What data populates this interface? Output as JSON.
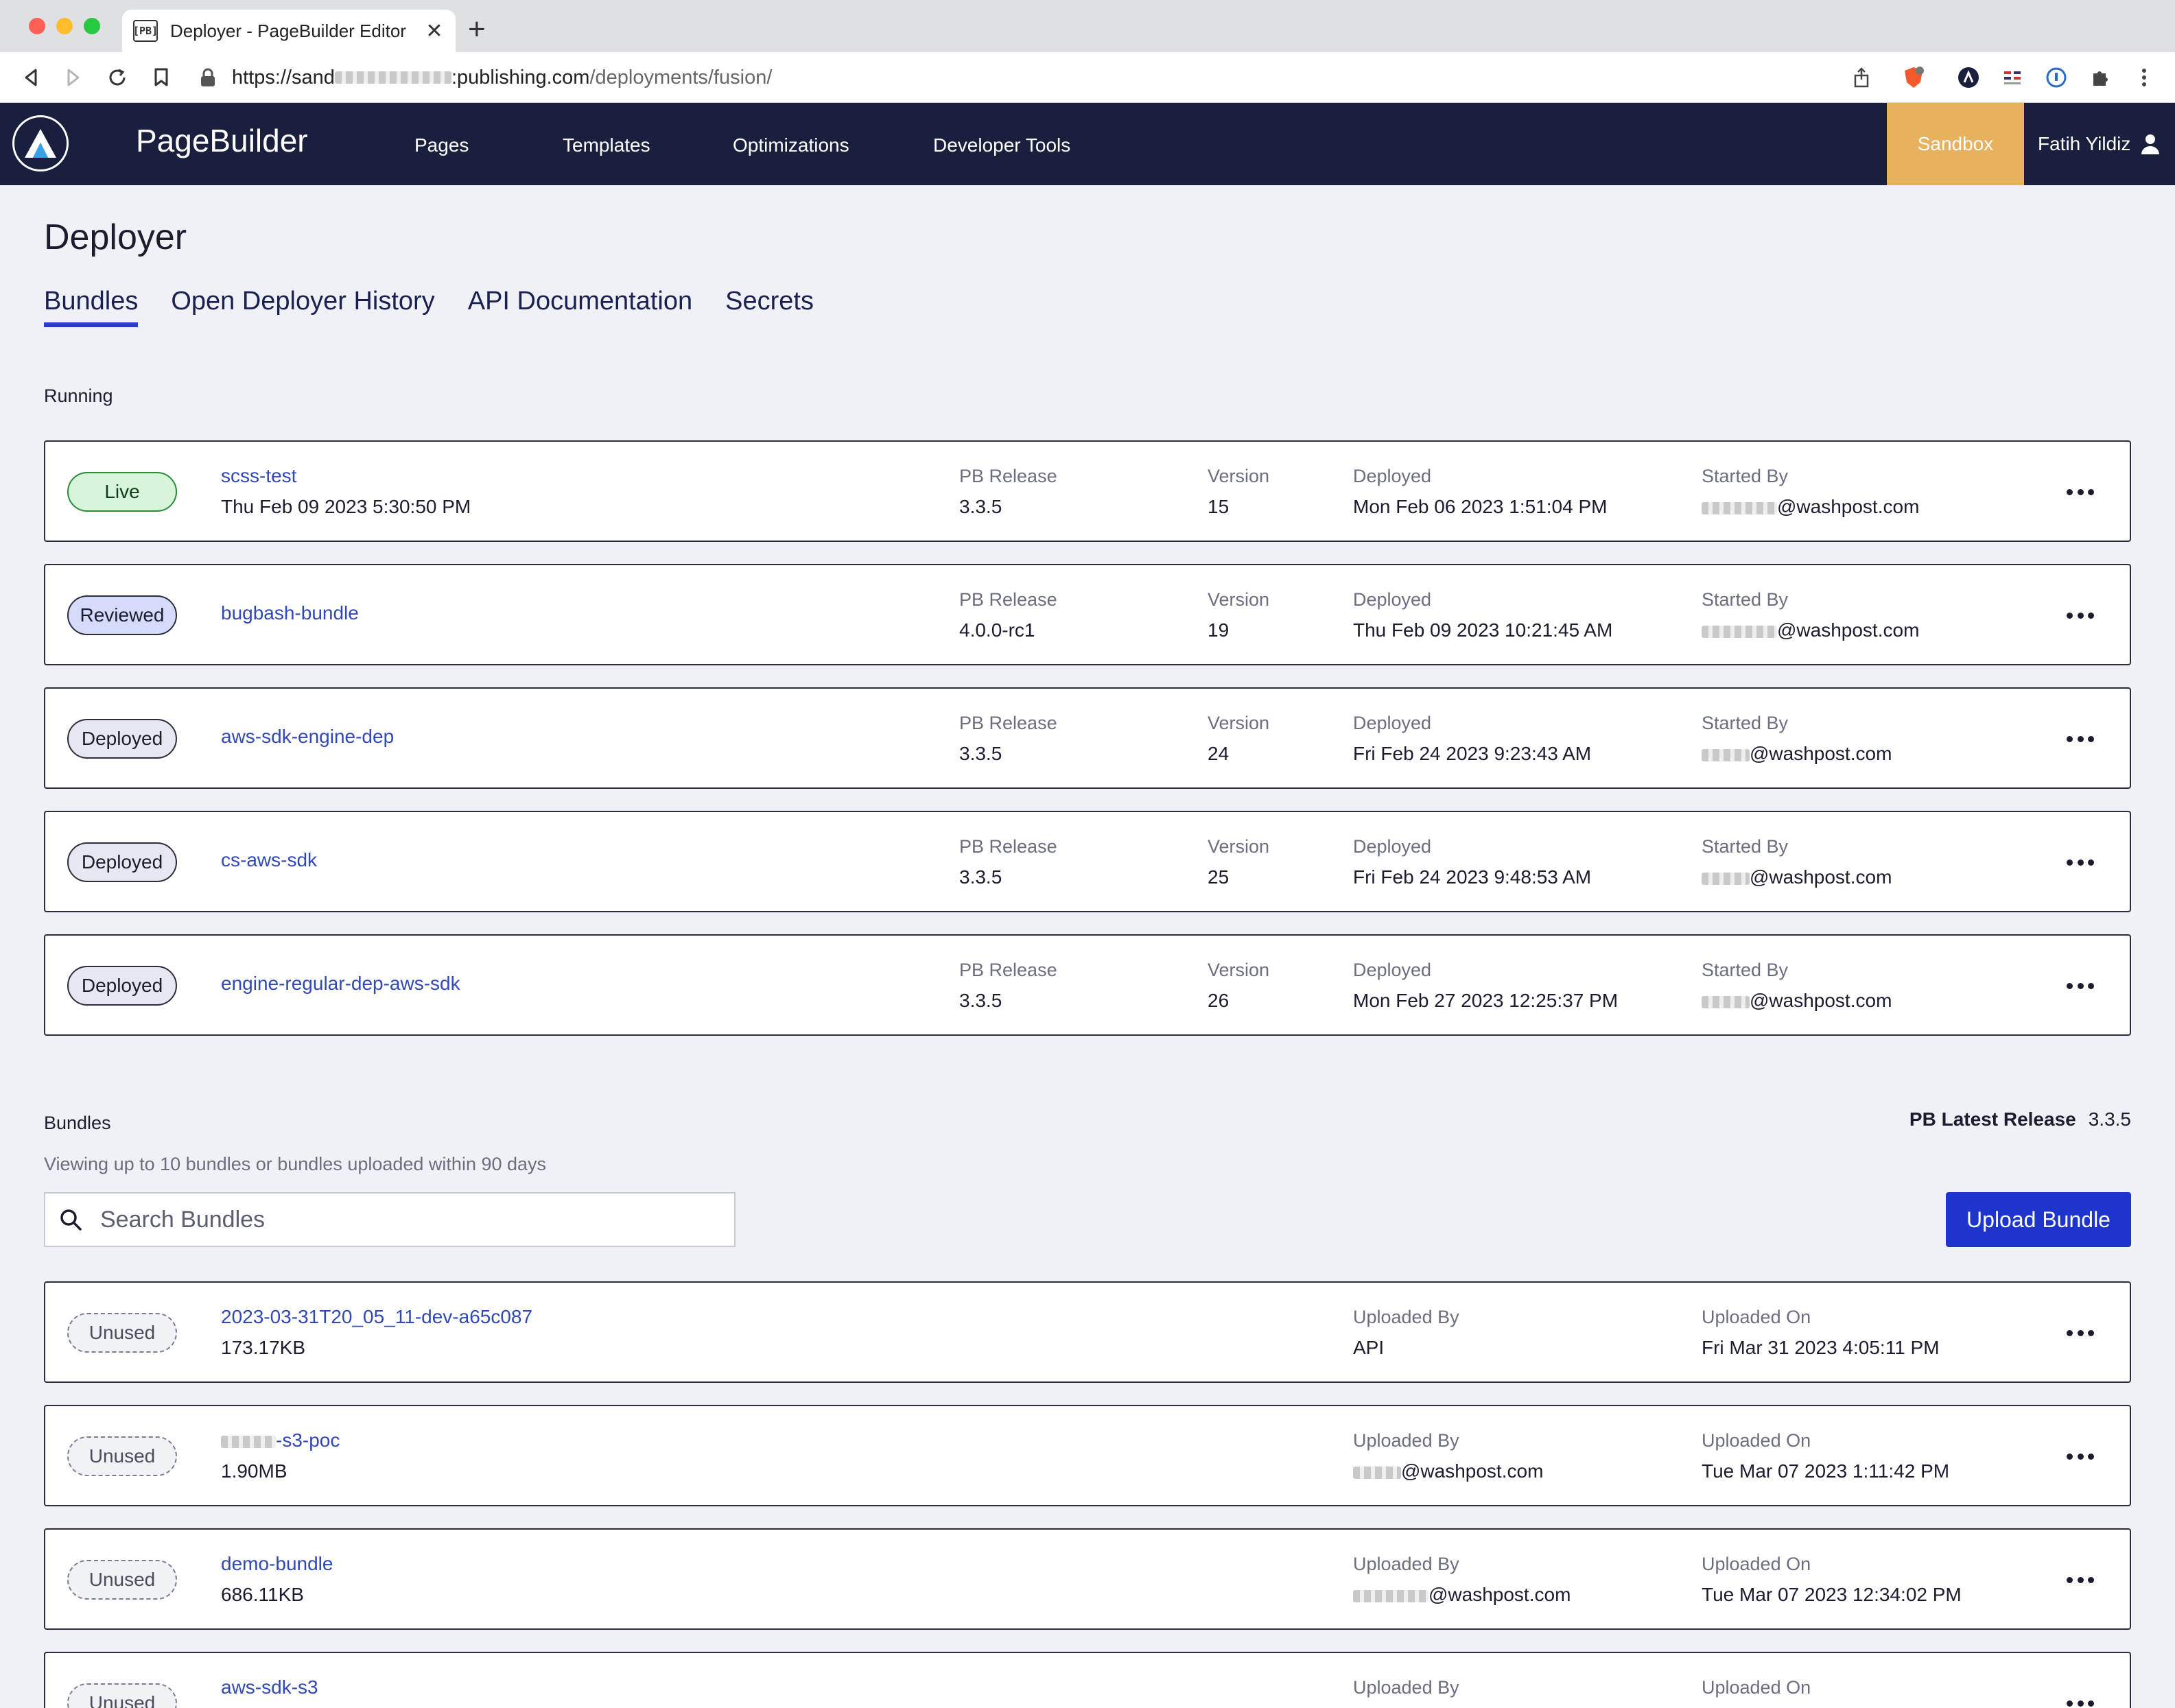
{
  "browser": {
    "tab_title": "Deployer - PageBuilder Editor",
    "favicon_text": "[PB]",
    "url_prefix": "https://sand",
    "url_domain": ":publishing.com",
    "url_path": "/deployments/fusion/"
  },
  "header": {
    "brand": "PageBuilder",
    "nav": [
      "Pages",
      "Templates",
      "Optimizations",
      "Developer Tools"
    ],
    "env": "Sandbox",
    "user": "Fatih Yildiz"
  },
  "page": {
    "title": "Deployer",
    "tabs": [
      "Bundles",
      "Open Deployer History",
      "API Documentation",
      "Secrets"
    ]
  },
  "running": {
    "label": "Running",
    "col_release": "PB Release",
    "col_version": "Version",
    "col_deployed": "Deployed",
    "col_started": "Started By",
    "items": [
      {
        "status": "Live",
        "name": "scss-test",
        "date": "Thu Feb 09 2023 5:30:50 PM",
        "release": "3.3.5",
        "version": "15",
        "deployed": "Mon Feb 06 2023 1:51:04 PM",
        "started_by": "@washpost.com"
      },
      {
        "status": "Reviewed",
        "name": "bugbash-bundle",
        "date": "",
        "release": "4.0.0-rc1",
        "version": "19",
        "deployed": "Thu Feb 09 2023 10:21:45 AM",
        "started_by": "@washpost.com"
      },
      {
        "status": "Deployed",
        "name": "aws-sdk-engine-dep",
        "date": "",
        "release": "3.3.5",
        "version": "24",
        "deployed": "Fri Feb 24 2023 9:23:43 AM",
        "started_by": "@washpost.com"
      },
      {
        "status": "Deployed",
        "name": "cs-aws-sdk",
        "date": "",
        "release": "3.3.5",
        "version": "25",
        "deployed": "Fri Feb 24 2023 9:48:53 AM",
        "started_by": "@washpost.com"
      },
      {
        "status": "Deployed",
        "name": "engine-regular-dep-aws-sdk",
        "date": "",
        "release": "3.3.5",
        "version": "26",
        "deployed": "Mon Feb 27 2023 12:25:37 PM",
        "started_by": "@washpost.com"
      }
    ]
  },
  "bundles": {
    "label": "Bundles",
    "latest_label": "PB Latest Release",
    "latest_value": "3.3.5",
    "subtitle": "Viewing up to 10 bundles or bundles uploaded within 90 days",
    "search_placeholder": "Search Bundles",
    "upload_label": "Upload Bundle",
    "col_uploaded_by": "Uploaded By",
    "col_uploaded_on": "Uploaded On",
    "items": [
      {
        "status": "Unused",
        "name": "2023-03-31T20_05_11-dev-a65c087",
        "size": "173.17KB",
        "uploaded_by": "API",
        "uploaded_on": "Fri Mar 31 2023 4:05:11 PM"
      },
      {
        "status": "Unused",
        "name": "-s3-poc",
        "size": "1.90MB",
        "uploaded_by": "@washpost.com",
        "uploaded_on": "Tue Mar 07 2023 1:11:42 PM"
      },
      {
        "status": "Unused",
        "name": "demo-bundle",
        "size": "686.11KB",
        "uploaded_by": "@washpost.com",
        "uploaded_on": "Tue Mar 07 2023 12:34:02 PM"
      },
      {
        "status": "Unused",
        "name": "aws-sdk-s3",
        "size": "",
        "uploaded_by": "",
        "uploaded_on": ""
      }
    ]
  }
}
